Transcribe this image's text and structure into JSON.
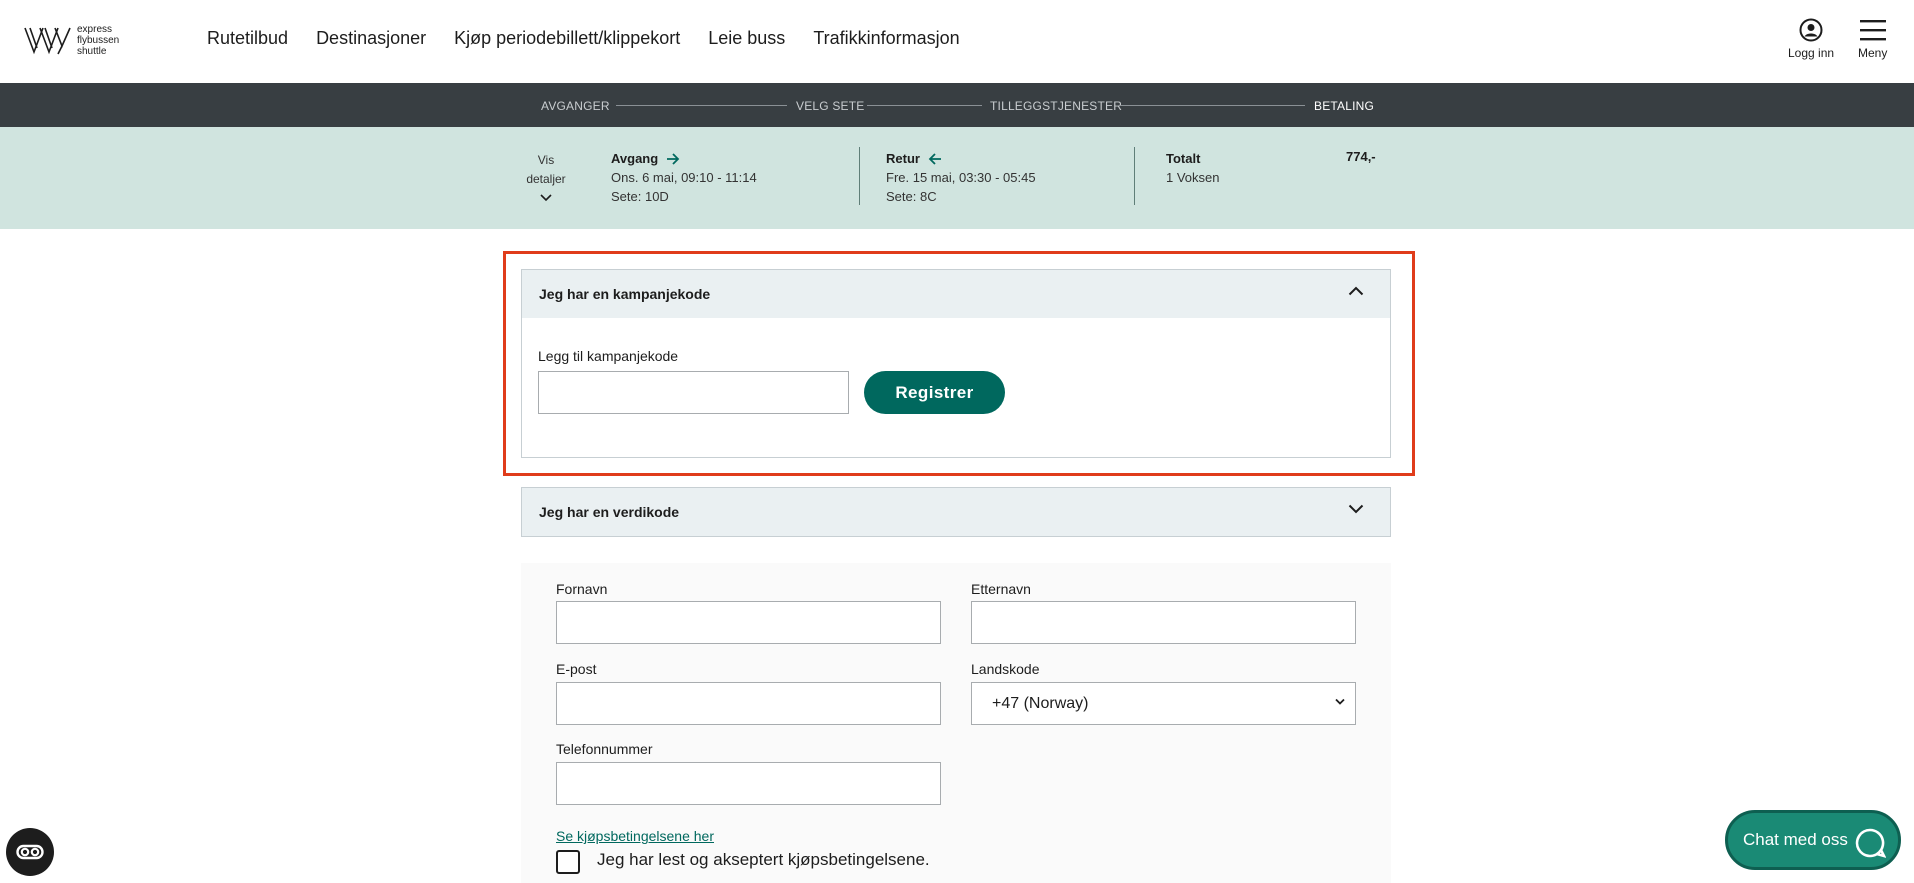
{
  "brand": {
    "logo_lines": [
      "express",
      "flybussen",
      "shuttle"
    ]
  },
  "nav": {
    "items": [
      "Rutetilbud",
      "Destinasjoner",
      "Kjøp periodebillett/klippekort",
      "Leie buss",
      "Trafikkinformasjon"
    ]
  },
  "header": {
    "login_label": "Logg inn",
    "menu_label": "Meny"
  },
  "steps": [
    "AVGANGER",
    "VELG SETE",
    "TILLEGGSTJENESTER",
    "BETALING"
  ],
  "summary": {
    "toggle_line1": "Vis",
    "toggle_line2": "detaljer",
    "outbound": {
      "title": "Avgang",
      "time": "Ons. 6 mai, 09:10 - 11:14",
      "seat": "Sete: 10D"
    },
    "return": {
      "title": "Retur",
      "time": "Fre. 15 mai, 03:30 - 05:45",
      "seat": "Sete: 8C"
    },
    "total": {
      "title": "Totalt",
      "passengers": "1 Voksen",
      "price": "774,-"
    }
  },
  "campaign": {
    "header": "Jeg har en kampanjekode",
    "field_label": "Legg til kampanjekode",
    "field_value": "",
    "button": "Registrer"
  },
  "voucher": {
    "header": "Jeg har en verdikode"
  },
  "form": {
    "first_name_label": "Fornavn",
    "last_name_label": "Etternavn",
    "email_label": "E-post",
    "country_code_label": "Landskode",
    "country_code_value": "+47 (Norway)",
    "phone_label": "Telefonnummer",
    "terms_link": "Se kjøpsbetingelsene her",
    "terms_checkbox": "Jeg har lest og akseptert kjøpsbetingelsene."
  },
  "chat": {
    "label": "Chat med oss"
  },
  "colors": {
    "accent": "#00685e",
    "highlight": "#e03c1b",
    "band": "#d0e4df",
    "steps_bg": "#383e42"
  }
}
